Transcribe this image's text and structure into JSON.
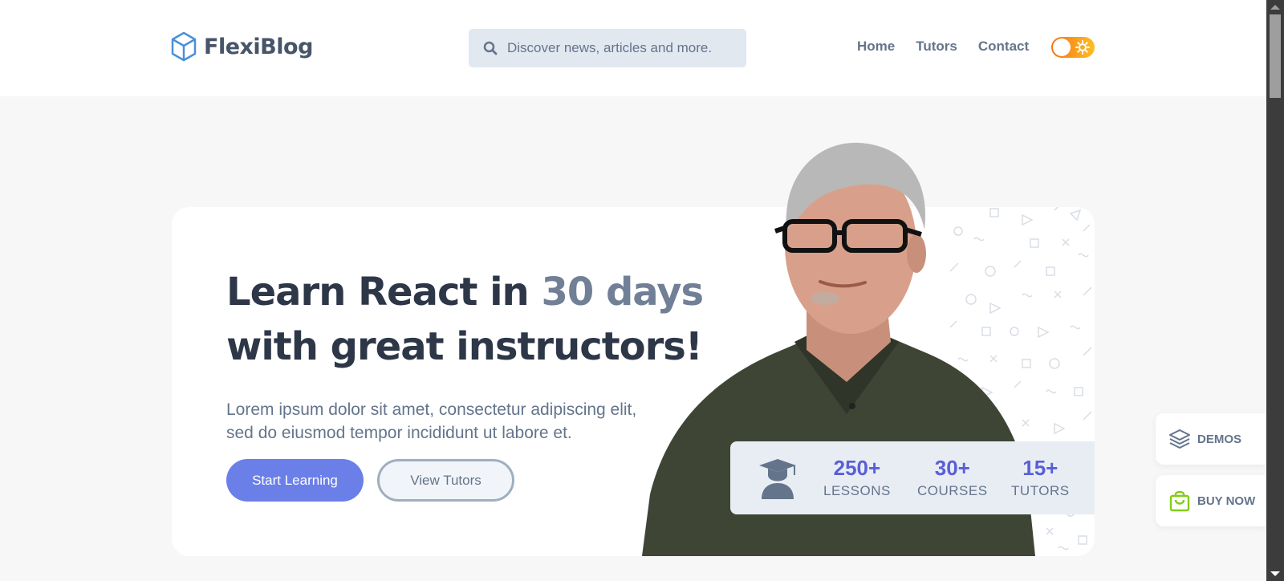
{
  "header": {
    "brand": "FlexiBlog",
    "search_placeholder": "Discover news, articles and more.",
    "nav": [
      "Home",
      "Tutors",
      "Contact"
    ]
  },
  "hero": {
    "headline_part1": "Learn React in ",
    "headline_accent": "30 days",
    "headline_part2": "with great instructors!",
    "lede_line1": "Lorem ipsum dolor sit amet, consectetur adipiscing elit,",
    "lede_line2": "sed do eiusmod tempor incididunt ut labore et.",
    "primary_button": "Start Learning",
    "secondary_button": "View Tutors"
  },
  "stats": [
    {
      "value": "250+",
      "label": "LESSONS"
    },
    {
      "value": "30+",
      "label": "COURSES"
    },
    {
      "value": "15+",
      "label": "TUTORS"
    }
  ],
  "side": {
    "demos": "DEMOS",
    "buy_now": "BUY NOW"
  },
  "colors": {
    "accent": "#6b7fe8",
    "stat_number": "#5a5fd6",
    "headline": "#2d3748",
    "buy_icon": "#84cc16"
  },
  "icons": [
    "cube-logo-icon",
    "search-icon",
    "sun-icon",
    "graduate-icon",
    "layers-icon",
    "shopping-bag-icon"
  ]
}
